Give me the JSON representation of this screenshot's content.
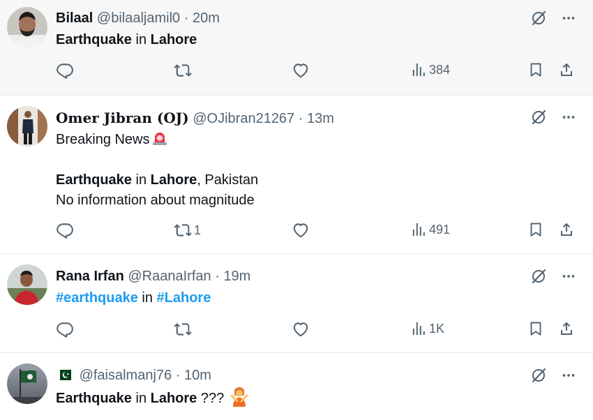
{
  "colors": {
    "text": "#0f1419",
    "muted": "#536471",
    "link": "#1d9bf0",
    "shaded_bg": "#f7f7f7"
  },
  "tweets": [
    {
      "name": "Bilaal",
      "handle": "@bilaaljamil0",
      "dot": "·",
      "time": "20m",
      "text": {
        "b1": "Earthquake",
        "t1": " in ",
        "b2": "Lahore"
      },
      "retweets": "",
      "views": "384"
    },
    {
      "name": "𝐎𝐦𝐞𝐫 𝐉𝐢𝐛𝐫𝐚𝐧 (𝐎𝐉)",
      "handle": "@OJibran21267",
      "dot": "·",
      "time": "13m",
      "text": {
        "line1": "Breaking News",
        "b1": "Earthquake",
        "t1": " in ",
        "b2": "Lahore",
        "t2": ", Pakistan",
        "line3": "No information about magnitude"
      },
      "retweets": "1",
      "views": "491"
    },
    {
      "name": "Rana Irfan",
      "handle": "@RaanaIrfan",
      "dot": "·",
      "time": "19m",
      "text": {
        "tag1": "#earthquake",
        "t1": " in ",
        "tag2": "#Lahore"
      },
      "retweets": "",
      "views": "1K"
    },
    {
      "name": "",
      "handle": "@faisalmanj76",
      "dot": "·",
      "time": "10m",
      "text": {
        "b1": "Earthquake",
        "t1": " in ",
        "b2": "Lahore",
        "t2": " ???"
      }
    }
  ],
  "icons": {
    "reply": "reply-icon",
    "retweet": "retweet-icon",
    "like": "heart-icon",
    "views": "views-chart-icon",
    "bookmark": "bookmark-icon",
    "share": "share-icon",
    "grok": "grok-icon",
    "more": "more-icon"
  }
}
